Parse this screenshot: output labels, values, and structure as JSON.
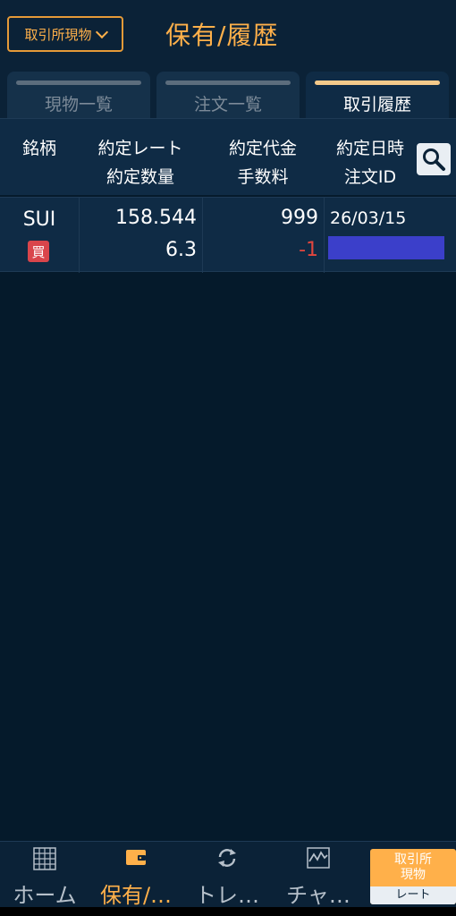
{
  "header": {
    "market_button": "取引所現物",
    "title": "保有/履歴"
  },
  "tabs": [
    {
      "label": "現物一覧",
      "active": false
    },
    {
      "label": "注文一覧",
      "active": false
    },
    {
      "label": "取引履歴",
      "active": true
    }
  ],
  "columns": {
    "symbol": "銘柄",
    "rate": "約定レート",
    "quantity": "約定数量",
    "amount": "約定代金",
    "fee": "手数料",
    "datetime": "約定日時",
    "order_id": "注文ID"
  },
  "search_icon": "search-icon",
  "rows": [
    {
      "symbol": "SUI",
      "side": "買",
      "rate": "158.544",
      "quantity": "6.3",
      "amount": "999",
      "fee": "-1",
      "datetime": "26/03/15",
      "order_id_redacted": true
    }
  ],
  "nav": {
    "home": "ホーム",
    "holdings": "保有/…",
    "trade": "トレ…",
    "chart": "チャ…",
    "rate_top_line1": "取引所",
    "rate_top_line2": "現物",
    "rate_bottom": "レート"
  },
  "colors": {
    "accent": "#ffb04a",
    "buy": "#d9454b",
    "negative": "#e0463e",
    "background": "#051a2b",
    "panel": "#0f2b45"
  }
}
